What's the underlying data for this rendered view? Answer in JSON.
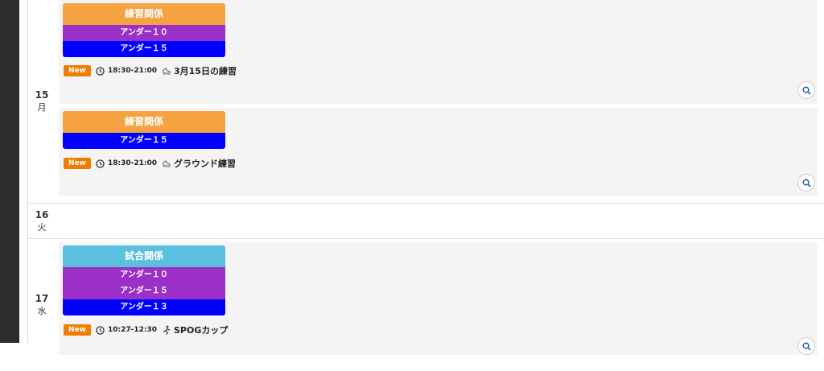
{
  "colors": {
    "practice": "#f5a241",
    "match": "#5bc0de",
    "u10": "#9b30c8",
    "u15_after_u10": "#9b30c8",
    "u15": "#0000ff",
    "u13": "#0000ff",
    "new_badge": "#f07d00"
  },
  "days": [
    {
      "day": "15",
      "weekday": "月",
      "events": [
        {
          "category": "練習関係",
          "teams": [
            "アンダー１０",
            "アンダー１５"
          ],
          "new_label": "New",
          "time": "18:30-21:00",
          "title": "3月15日の練習",
          "icon": "cleat-icon"
        },
        {
          "category": "練習関係",
          "teams": [
            "アンダー１５"
          ],
          "new_label": "New",
          "time": "18:30-21:00",
          "title": "グラウンド練習",
          "icon": "cleat-icon"
        }
      ]
    },
    {
      "day": "16",
      "weekday": "火",
      "events": []
    },
    {
      "day": "17",
      "weekday": "水",
      "events": [
        {
          "category": "試合関係",
          "teams": [
            "アンダー１０",
            "アンダー１５",
            "アンダー１３"
          ],
          "new_label": "New",
          "time": "10:27-12:30",
          "title": "SPOGカップ",
          "icon": "player-icon"
        }
      ]
    }
  ]
}
